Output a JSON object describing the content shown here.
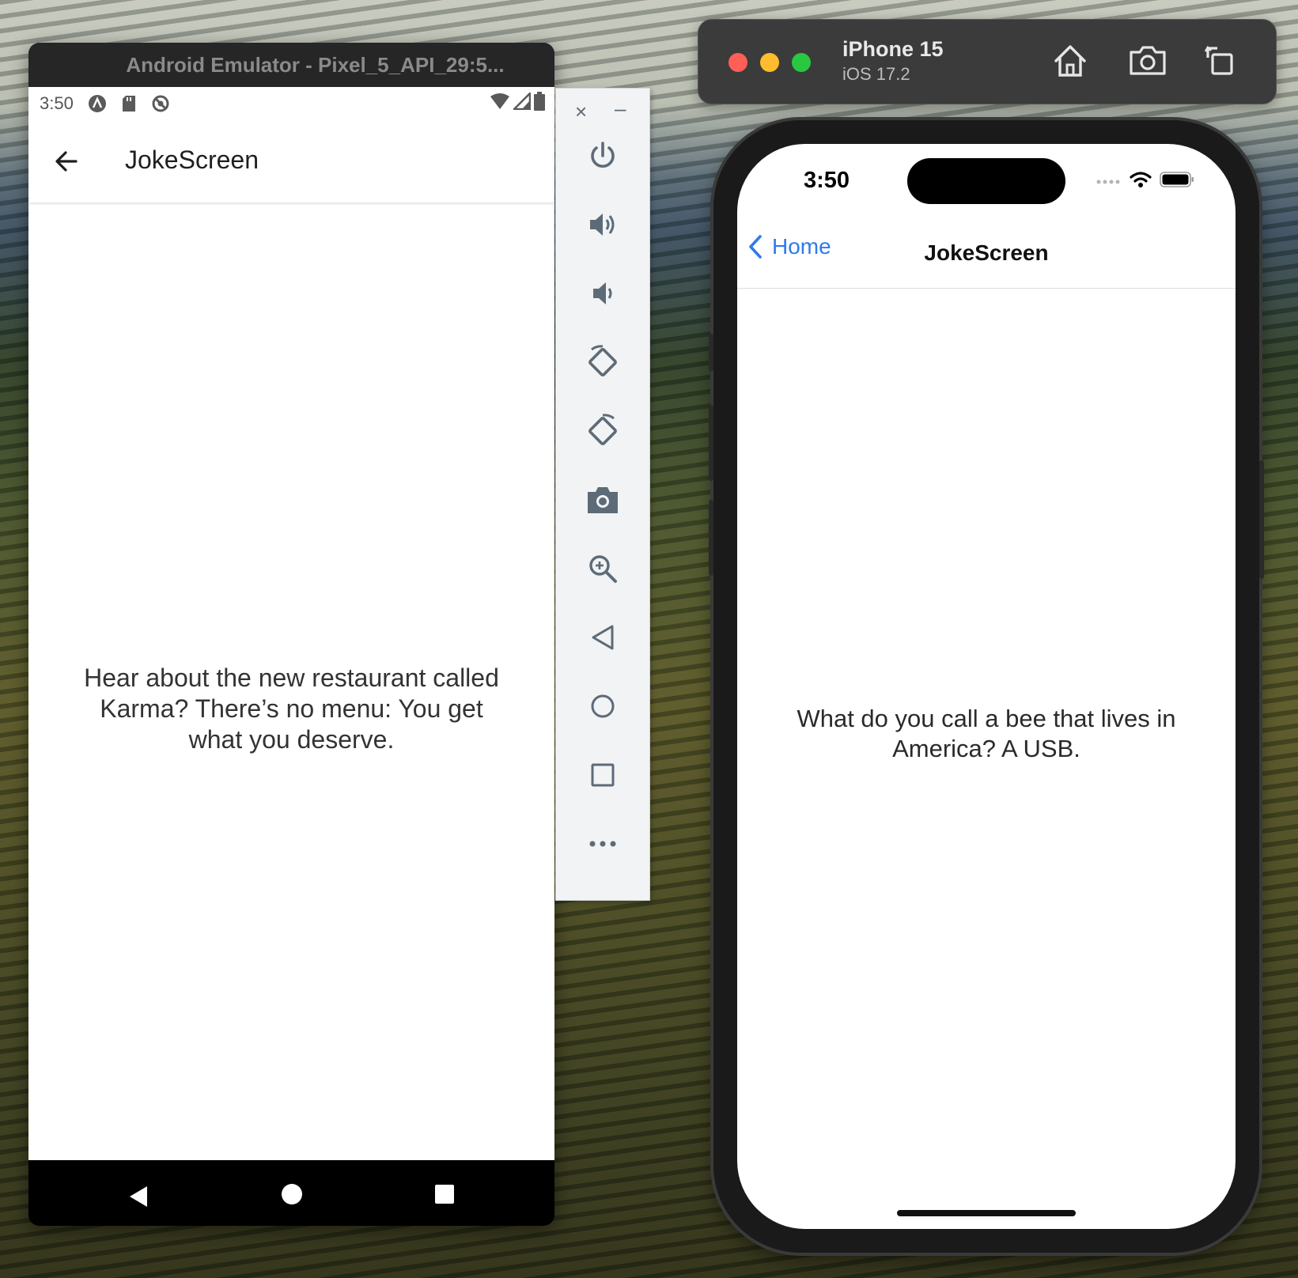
{
  "android": {
    "window_title": "Android Emulator - Pixel_5_API_29:5...",
    "status_time": "3:50",
    "app_title": "JokeScreen",
    "joke_text": "Hear about the new restaurant called Karma? There’s no menu: You get what you deserve."
  },
  "toolbar": {
    "close_label": "×",
    "minimize_label": "–",
    "buttons": [
      "power-icon",
      "volume-up-icon",
      "volume-down-icon",
      "rotate-left-icon",
      "rotate-right-icon",
      "camera-icon",
      "zoom-icon",
      "back-icon",
      "home-icon",
      "overview-icon",
      "more-icon"
    ]
  },
  "ios": {
    "device_name": "iPhone 15",
    "ios_version": "iOS 17.2",
    "status_time": "3:50",
    "back_label": "Home",
    "nav_title": "JokeScreen",
    "joke_text": "What do you call a bee that lives in America? A USB."
  },
  "colors": {
    "ios_accent": "#2f7bea",
    "traffic_red": "#ff5f57",
    "traffic_yellow": "#febc2e",
    "traffic_green": "#28c840",
    "toolbar_icon": "#5d6b78"
  }
}
